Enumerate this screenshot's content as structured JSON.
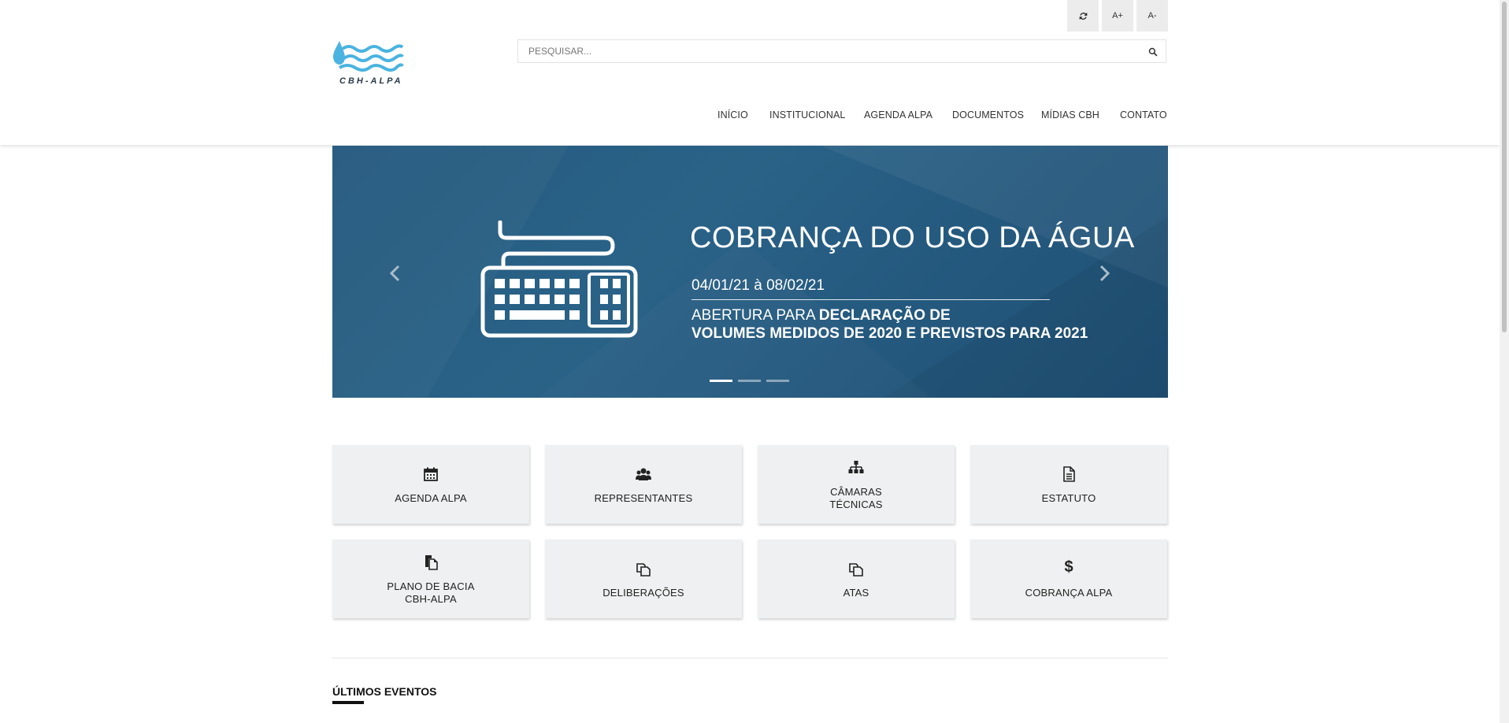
{
  "accessibility": {
    "contrast_icon": "refresh-icon",
    "font_increase_label": "A+",
    "font_decrease_label": "A-"
  },
  "logo": {
    "text": "CBH-ALPA"
  },
  "search": {
    "placeholder": "PESQUISAR...",
    "value": "",
    "button_icon": "search-icon"
  },
  "nav": {
    "items": [
      {
        "label": "INÍCIO"
      },
      {
        "label": "INSTITUCIONAL"
      },
      {
        "label": "AGENDA ALPA"
      },
      {
        "label": "DOCUMENTOS"
      },
      {
        "label": "MÍDIAS CBH"
      },
      {
        "label": "CONTATO"
      }
    ]
  },
  "slider": {
    "image_icon": "keyboard-icon",
    "title": "COBRANÇA DO USO DA ÁGUA",
    "date": "04/01/21 à 08/02/21",
    "line1_normal": "ABERTURA PARA ",
    "line1_bold": "DECLARAÇÃO DE",
    "line2": "VOLUMES MEDIDOS DE 2020 E PREVISTOS PARA 2021",
    "prev_icon": "chevron-left-icon",
    "next_icon": "chevron-right-icon",
    "slide_count": 3,
    "active_slide": 1,
    "background_color": "#25597e"
  },
  "tiles": [
    {
      "line1": "AGENDA ALPA",
      "line2": "",
      "icon": "calendar-icon"
    },
    {
      "line1": "REPRESENTANTES",
      "line2": "",
      "icon": "users-icon"
    },
    {
      "line1": "CÂMARAS",
      "line2": "TÉCNICAS",
      "icon": "sitemap-icon"
    },
    {
      "line1": "ESTATUTO",
      "line2": "",
      "icon": "document-icon"
    },
    {
      "line1": "PLANO DE BACIA",
      "line2": "CBH-ALPA",
      "icon": "files-icon"
    },
    {
      "line1": "DELIBERAÇÕES",
      "line2": "",
      "icon": "copy-icon"
    },
    {
      "line1": "ATAS",
      "line2": "",
      "icon": "copy-icon"
    },
    {
      "line1": "COBRANÇA ALPA",
      "line2": "",
      "icon": "dollar-icon"
    }
  ],
  "section": {
    "title": "ÚLTIMOS EVENTOS"
  },
  "colors": {
    "accent": "#25597e",
    "tile_bg": "#eef0f1",
    "logo_blue": "#4ab3e0"
  }
}
